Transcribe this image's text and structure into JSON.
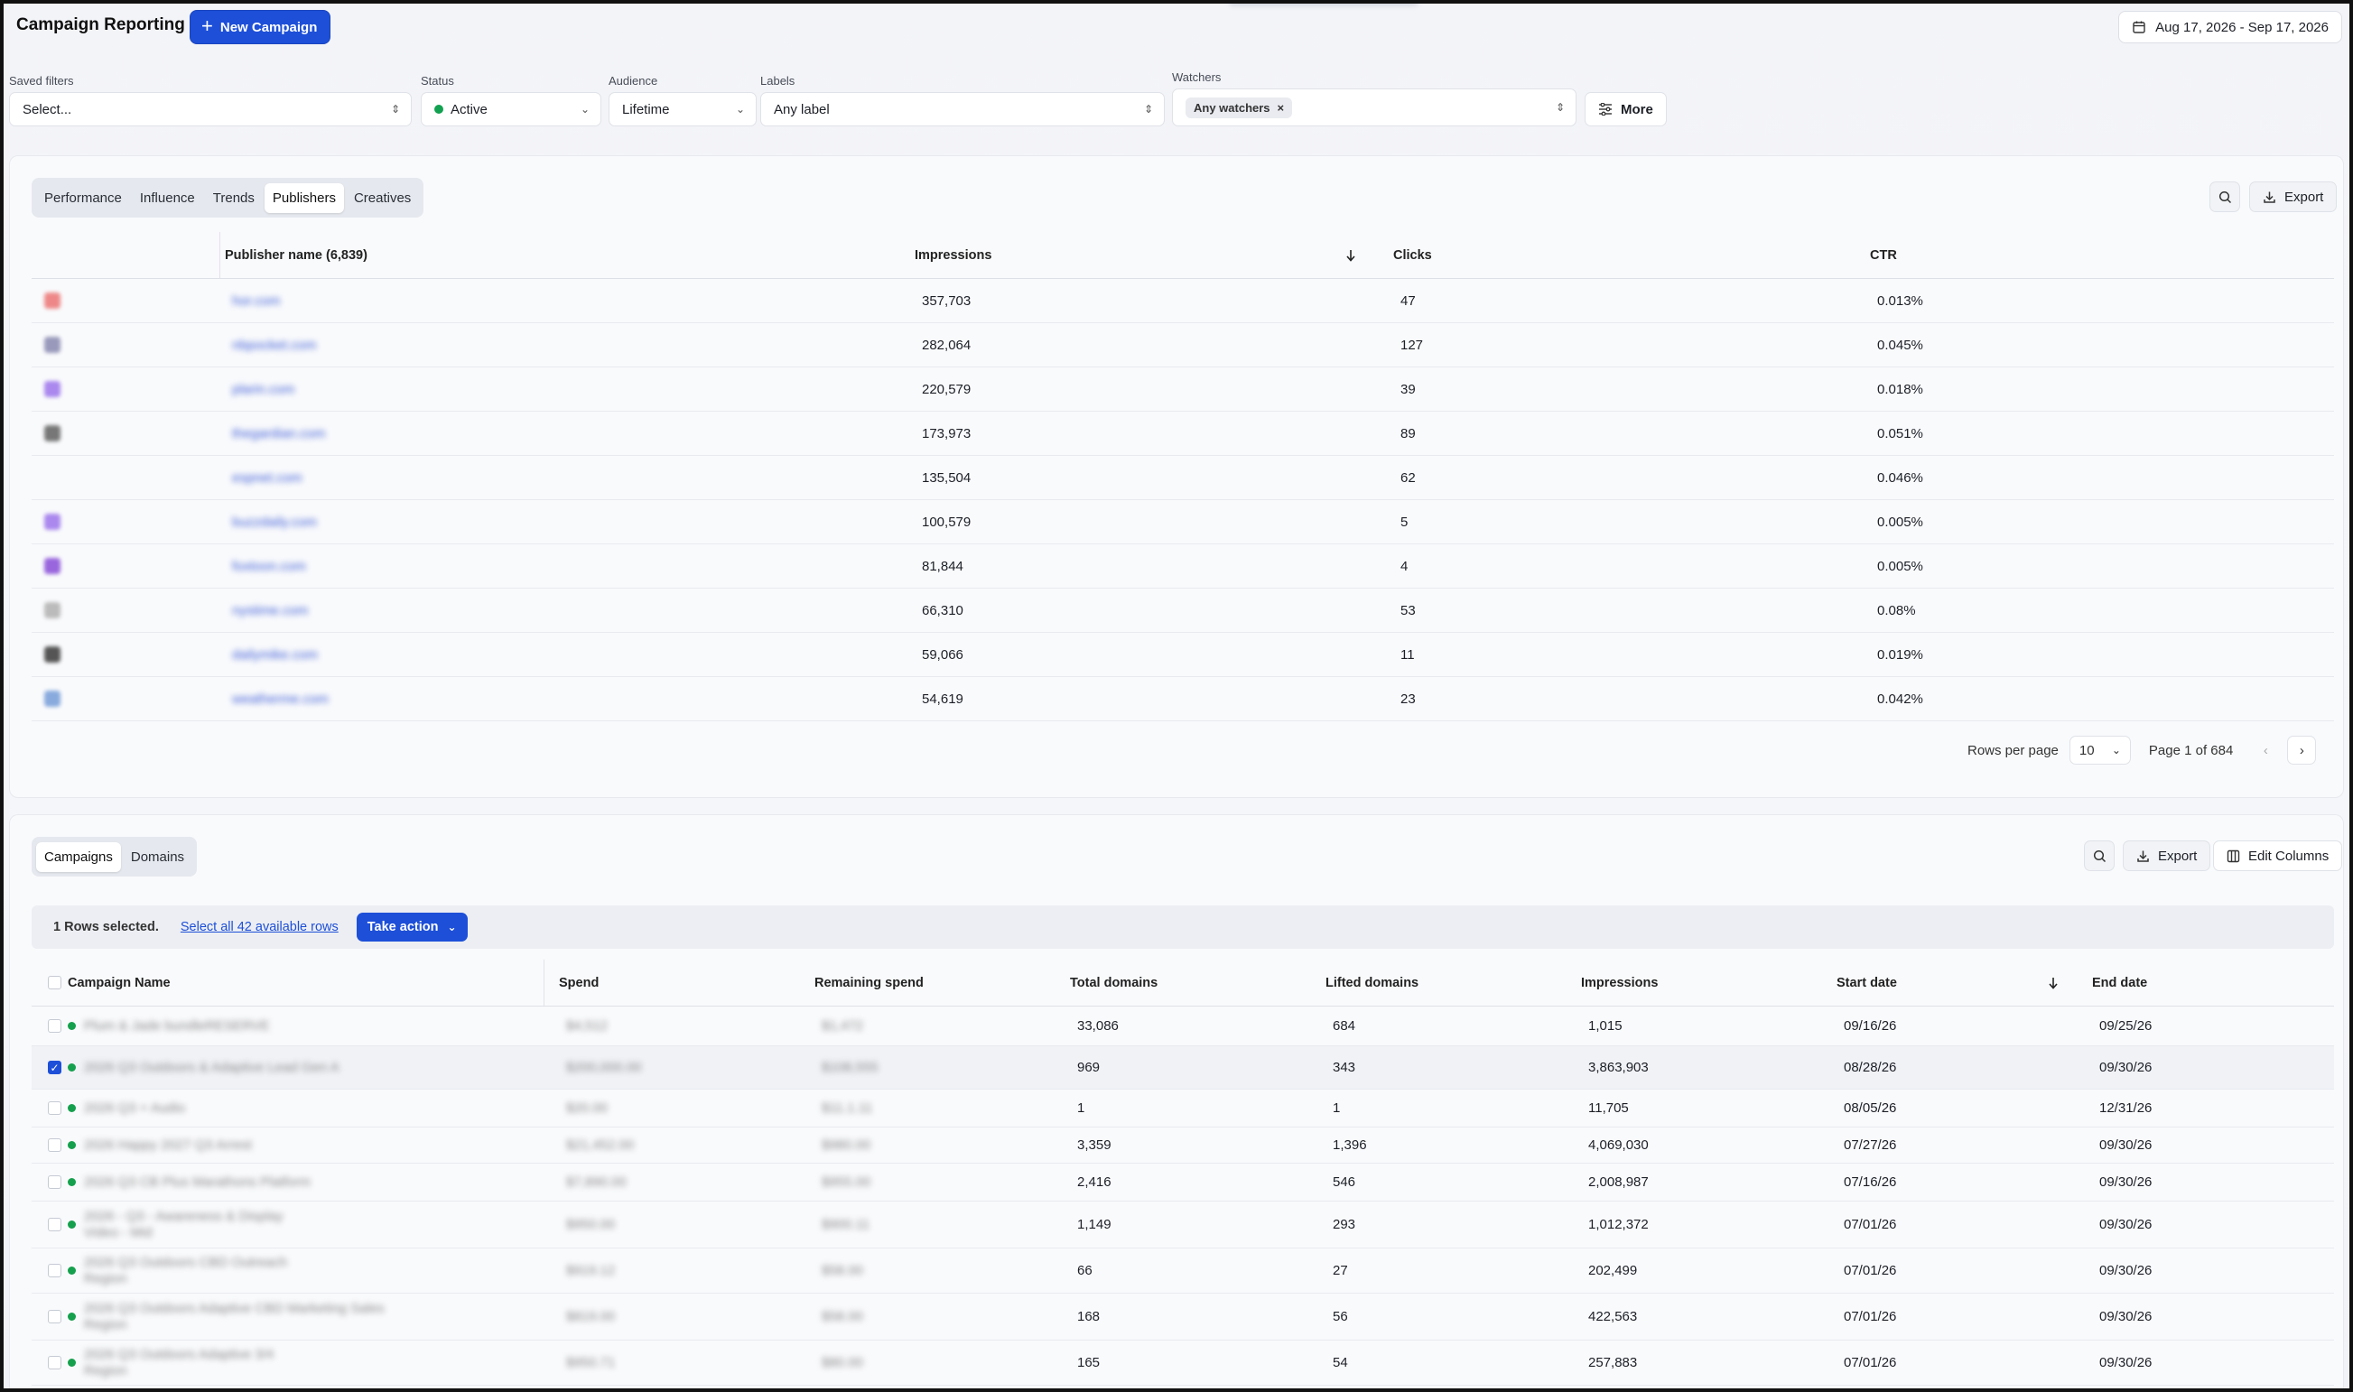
{
  "header": {
    "title": "Campaign Reporting",
    "new_campaign_label": "New Campaign",
    "date_range": "Aug 17, 2026 - Sep 17, 2026"
  },
  "filters": {
    "saved_filters": {
      "label": "Saved filters",
      "value": "Select..."
    },
    "status": {
      "label": "Status",
      "value": "Active"
    },
    "audience": {
      "label": "Audience",
      "value": "Lifetime"
    },
    "labels": {
      "label": "Labels",
      "value": "Any label"
    },
    "watchers": {
      "label": "Watchers",
      "chip": "Any watchers"
    },
    "more_label": "More"
  },
  "publishers_card": {
    "tabs": [
      "Performance",
      "Influence",
      "Trends",
      "Publishers",
      "Creatives"
    ],
    "active_tab": "Publishers",
    "export_label": "Export",
    "columns": {
      "publisher": "Publisher name (6,839)",
      "impressions": "Impressions",
      "clicks": "Clicks",
      "ctr": "CTR"
    },
    "rows": [
      {
        "name": "hor.com",
        "impressions": "357,703",
        "clicks": "47",
        "ctr": "0.013%"
      },
      {
        "name": "nbpocket.com",
        "impressions": "282,064",
        "clicks": "127",
        "ctr": "0.045%"
      },
      {
        "name": "plarin.com",
        "impressions": "220,579",
        "clicks": "39",
        "ctr": "0.018%"
      },
      {
        "name": "thegardian.com",
        "impressions": "173,973",
        "clicks": "89",
        "ctr": "0.051%"
      },
      {
        "name": "espnet.com",
        "impressions": "135,504",
        "clicks": "62",
        "ctr": "0.046%"
      },
      {
        "name": "buzzdaily.com",
        "impressions": "100,579",
        "clicks": "5",
        "ctr": "0.005%"
      },
      {
        "name": "foxtoon.com",
        "impressions": "81,844",
        "clicks": "4",
        "ctr": "0.005%"
      },
      {
        "name": "nystime.com",
        "impressions": "66,310",
        "clicks": "53",
        "ctr": "0.08%"
      },
      {
        "name": "dailymike.com",
        "impressions": "59,066",
        "clicks": "11",
        "ctr": "0.019%"
      },
      {
        "name": "weatherme.com",
        "impressions": "54,619",
        "clicks": "23",
        "ctr": "0.042%"
      }
    ],
    "pagination": {
      "rows_per_page_label": "Rows per page",
      "rows_per_page": "10",
      "page_text": "Page 1 of 684"
    }
  },
  "campaigns_card": {
    "tabs": [
      "Campaigns",
      "Domains"
    ],
    "active_tab": "Campaigns",
    "export_label": "Export",
    "edit_columns_label": "Edit Columns",
    "selection": {
      "selected_text": "1 Rows selected.",
      "select_all_text": "Select all 42 available rows",
      "action_label": "Take action"
    },
    "columns": {
      "name": "Campaign Name",
      "spend": "Spend",
      "remaining": "Remaining spend",
      "total_domains": "Total domains",
      "lifted_domains": "Lifted domains",
      "impressions": "Impressions",
      "start": "Start date",
      "end": "End date"
    },
    "rows": [
      {
        "name": "Plum & Jade bundleRESERVE",
        "name2": "",
        "spend": "$4,512",
        "remaining": "$1,472",
        "total_domains": "33,086",
        "lifted_domains": "684",
        "impressions": "1,015",
        "start": "09/16/26",
        "end": "09/25/26",
        "checked": false
      },
      {
        "name": "2026 Q3 Outdoors & Adaptive Lead Gen A",
        "name2": "",
        "spend": "$200,000.00",
        "remaining": "$108,555",
        "total_domains": "969",
        "lifted_domains": "343",
        "impressions": "3,863,903",
        "start": "08/28/26",
        "end": "09/30/26",
        "checked": true
      },
      {
        "name": "2026 Q3 + Audio",
        "name2": "",
        "spend": "$20.00",
        "remaining": "$11.1.11",
        "total_domains": "1",
        "lifted_domains": "1",
        "impressions": "11,705",
        "start": "08/05/26",
        "end": "12/31/26",
        "checked": false
      },
      {
        "name": "2026 Happy 2027 Q3 Arrest",
        "name2": "",
        "spend": "$21,452.00",
        "remaining": "$980.00",
        "total_domains": "3,359",
        "lifted_domains": "1,396",
        "impressions": "4,069,030",
        "start": "07/27/26",
        "end": "09/30/26",
        "checked": false
      },
      {
        "name": "2026 Q3 CB Plus Marathons Platform",
        "name2": "",
        "spend": "$7,890.00",
        "remaining": "$955.00",
        "total_domains": "2,416",
        "lifted_domains": "546",
        "impressions": "2,008,987",
        "start": "07/16/26",
        "end": "09/30/26",
        "checked": false
      },
      {
        "name": "2026 - Q3 - Awareness & Display",
        "name2": "Video - Mid",
        "spend": "$950.00",
        "remaining": "$900.11",
        "total_domains": "1,149",
        "lifted_domains": "293",
        "impressions": "1,012,372",
        "start": "07/01/26",
        "end": "09/30/26",
        "checked": false
      },
      {
        "name": "2026 Q3 Outdoors CBD Outreach",
        "name2": "Region",
        "spend": "$919.12",
        "remaining": "$58.00",
        "total_domains": "66",
        "lifted_domains": "27",
        "impressions": "202,499",
        "start": "07/01/26",
        "end": "09/30/26",
        "checked": false
      },
      {
        "name": "2026 Q3 Outdoors Adaptive CBD Marketing Sales",
        "name2": "Region",
        "spend": "$819.00",
        "remaining": "$58.00",
        "total_domains": "168",
        "lifted_domains": "56",
        "impressions": "422,563",
        "start": "07/01/26",
        "end": "09/30/26",
        "checked": false
      },
      {
        "name": "2026 Q3 Outdoors Adaptive 3/4",
        "name2": "Region",
        "spend": "$950.71",
        "remaining": "$80.00",
        "total_domains": "165",
        "lifted_domains": "54",
        "impressions": "257,883",
        "start": "07/01/26",
        "end": "09/30/26",
        "checked": false
      }
    ]
  },
  "colors": {
    "accent": "#1d4fd8",
    "active_green": "#12a150",
    "link": "#1d4fd8"
  }
}
